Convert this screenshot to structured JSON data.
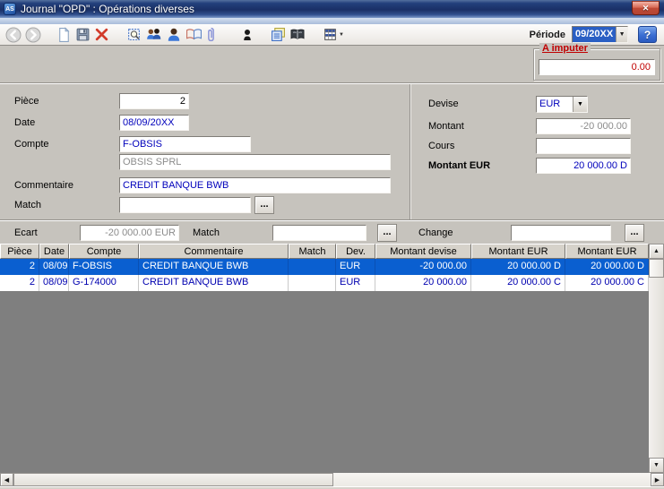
{
  "window": {
    "title": "Journal \"OPD\" : Opérations diverses",
    "app_badge": "AS",
    "close_glyph": "✕"
  },
  "toolbar": {
    "period_label": "Période",
    "period_value": "09/20XX",
    "help_glyph": "?",
    "icons": [
      "back-icon",
      "forward-icon",
      "new-document-icon",
      "save-icon",
      "delete-icon",
      "print-preview-icon",
      "users-icon",
      "user-icon",
      "journal-book-icon",
      "attachment-icon",
      "contact-icon",
      "forms-icon",
      "dictionary-icon",
      "grid-options-icon"
    ]
  },
  "imputer_box": {
    "label": "A imputer",
    "value": "0.00"
  },
  "form": {
    "piece_label": "Pièce",
    "piece_value": "2",
    "date_label": "Date",
    "date_value": "08/09/20XX",
    "compte_label": "Compte",
    "compte_value": "F-OBSIS",
    "compte_name_value": "OBSIS SPRL",
    "commentaire_label": "Commentaire",
    "commentaire_value": "CREDIT BANQUE BWB",
    "match_label": "Match",
    "match_value": "",
    "browse_glyph": "...",
    "devise_label": "Devise",
    "devise_value": "EUR",
    "montant_label": "Montant",
    "montant_value": "-20 000.00",
    "cours_label": "Cours",
    "cours_value": "",
    "montant_eur_label": "Montant EUR",
    "montant_eur_value": "20 000.00 D"
  },
  "ecart_bar": {
    "ecart_label": "Ecart",
    "ecart_value": "-20 000.00 EUR",
    "match_label": "Match",
    "match_value": "",
    "change_label": "Change",
    "change_value": "",
    "browse_glyph": "..."
  },
  "table": {
    "columns": [
      "Pièce",
      "Date",
      "Compte",
      "Commentaire",
      "Match",
      "Dev.",
      "Montant devise",
      "Montant EUR",
      "Montant EUR"
    ],
    "rows": [
      {
        "piece": "2",
        "date": "08/09",
        "compte": "F-OBSIS",
        "commentaire": "CREDIT BANQUE BWB",
        "match": "",
        "dev": "EUR",
        "montant_devise": "-20 000.00",
        "montant_eur": "20 000.00 D",
        "montant_eur_2": "20 000.00 D",
        "selected": true
      },
      {
        "piece": "2",
        "date": "08/09",
        "compte": "G-174000",
        "commentaire": "CREDIT BANQUE BWB",
        "match": "",
        "dev": "EUR",
        "montant_devise": "20 000.00",
        "montant_eur": "20 000.00 C",
        "montant_eur_2": "20 000.00 C",
        "selected": false
      }
    ]
  },
  "colors": {
    "selection_blue": "#0a5fd0",
    "entry_text_blue": "#0000bb",
    "alert_red": "#c00000",
    "disabled_gray": "#8c8c8c"
  }
}
